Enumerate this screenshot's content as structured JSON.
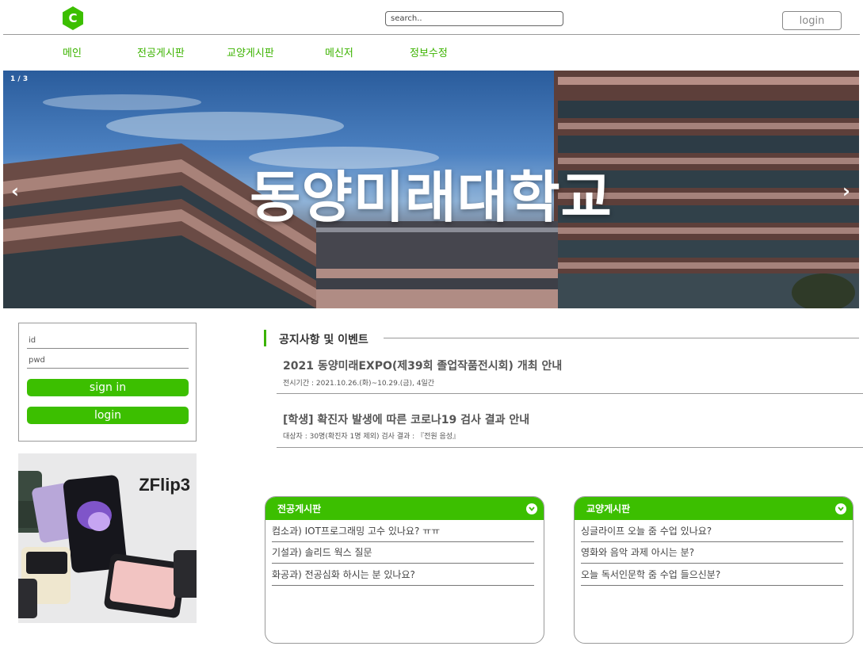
{
  "header": {
    "logo_letter": "C",
    "search_placeholder": "search..",
    "login_label": "login",
    "accent_color": "#3cbf00"
  },
  "nav": {
    "items": [
      "메인",
      "전공게시판",
      "교양게시판",
      "메신저",
      "정보수정"
    ]
  },
  "hero": {
    "slide_counter": "1 / 3",
    "title": "동양미래대학교",
    "prev_icon": "‹",
    "next_icon": "›"
  },
  "login_box": {
    "id_placeholder": "id",
    "pwd_placeholder": "pwd",
    "sign_in_label": "sign in",
    "login_label": "login"
  },
  "ad": {
    "text": "ZFlip3"
  },
  "notice": {
    "heading": "공지사항 및 이벤트",
    "items": [
      {
        "title": "2021 동양미래EXPO(제39회 졸업작품전시회) 개최 안내",
        "sub": "전시기간 : 2021.10.26.(화)~10.29.(금), 4일간"
      },
      {
        "title": "[학생] 확진자 발생에 따른 코로나19 검사 결과 안내",
        "sub": "대상자 : 30명(확진자 1명 제외) 검사 결과 : 『전원 음성』"
      }
    ]
  },
  "boards": [
    {
      "title": "전공게시판",
      "posts": [
        "컴소과) IOT프로그래밍 고수 있나요? ㅠㅠ",
        "기설과) 솔리드 웍스 질문",
        "화공과) 전공심화 하시는 분 있나요?"
      ]
    },
    {
      "title": "교양게시판",
      "posts": [
        "싱글라이프 오늘 줌 수업 있나요?",
        "영화와 음악 과제 아시는 분?",
        "오늘 독서인문학 줌 수업 들으신분?"
      ]
    }
  ]
}
